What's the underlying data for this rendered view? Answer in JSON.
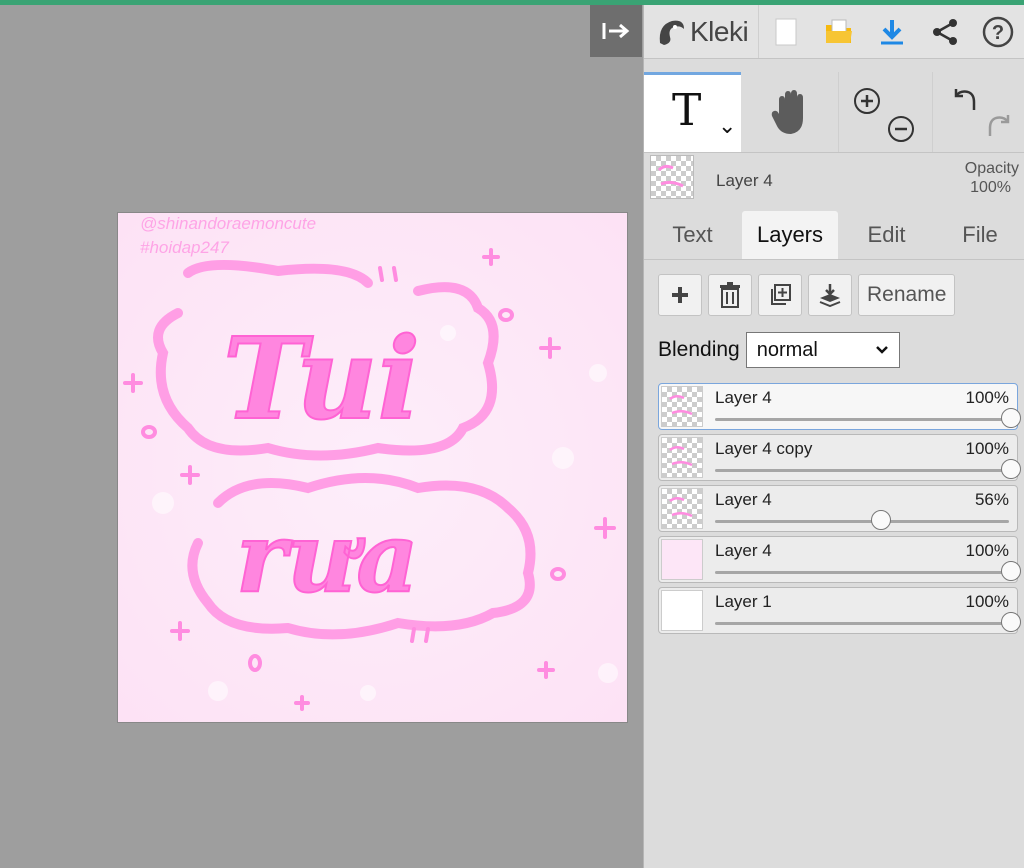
{
  "app": {
    "name": "Kleki"
  },
  "canvas": {
    "watermark_line1": "@shinandoraemoncute",
    "watermark_line2": "#hoidap247",
    "word_top": "Tui",
    "word_bottom": "rưa",
    "colors": {
      "background": "#fde6f7",
      "ink": "#ff8ce0",
      "ink_light": "#ffb5eb"
    }
  },
  "toolbar": {
    "collapse_icon": "collapse-right-icon",
    "icons": [
      "new-file-icon",
      "open-folder-icon",
      "download-icon",
      "share-icon",
      "help-icon"
    ]
  },
  "tools": {
    "active": "text",
    "text_tool_glyph": "T",
    "dropdown_glyph": "⌄"
  },
  "current_layer": {
    "name": "Layer 4",
    "opacity_label": "Opacity",
    "opacity_value": "100%"
  },
  "tabs": [
    {
      "label": "Text"
    },
    {
      "label": "Layers"
    },
    {
      "label": "Edit"
    },
    {
      "label": "File"
    }
  ],
  "layer_actions": {
    "rename_label": "Rename"
  },
  "blending": {
    "label": "Blending",
    "selected": "normal"
  },
  "layers": [
    {
      "name": "Layer 4",
      "opacity": "100%",
      "value": 1.0,
      "selected": true
    },
    {
      "name": "Layer 4 copy",
      "opacity": "100%",
      "value": 1.0,
      "selected": false
    },
    {
      "name": "Layer 4",
      "opacity": "56%",
      "value": 0.56,
      "selected": false
    },
    {
      "name": "Layer 4",
      "opacity": "100%",
      "value": 1.0,
      "selected": false
    },
    {
      "name": "Layer 1",
      "opacity": "100%",
      "value": 1.0,
      "selected": false
    }
  ],
  "colors": {
    "accent": "#3aa374",
    "download_blue": "#1e88e5",
    "folder_yellow": "#f6b90f",
    "selection_border": "#7aa6dd"
  }
}
